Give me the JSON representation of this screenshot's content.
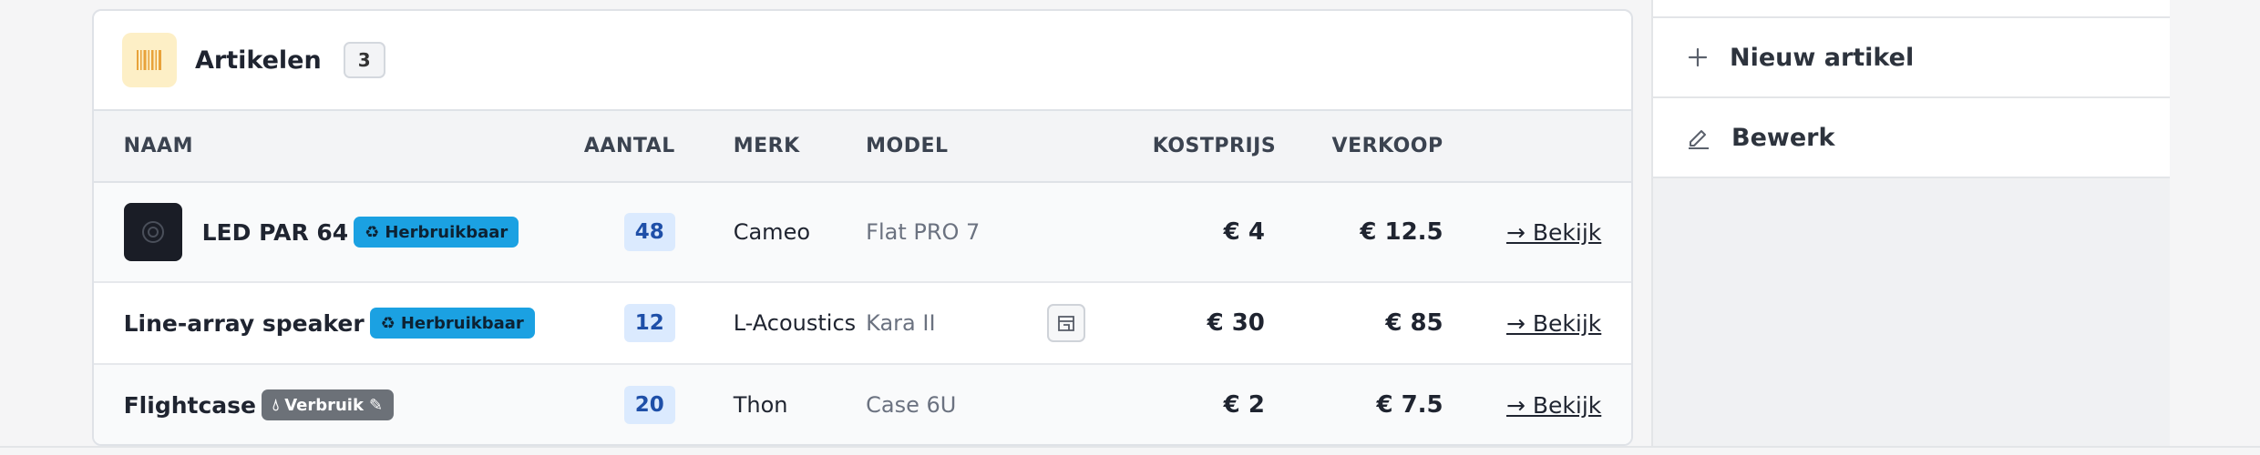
{
  "card": {
    "title": "Artikelen",
    "count": "3",
    "icon": "barcode-icon",
    "columns": {
      "naam": "NAAM",
      "aantal": "AANTAL",
      "merk": "MERK",
      "model": "MODEL",
      "kostprijs": "KOSTPRIJS",
      "verkoop": "VERKOOP"
    },
    "rows": [
      {
        "name": "LED PAR 64",
        "badge": "Herbruikbaar",
        "badge_icon": "recycle-icon",
        "qty": "48",
        "brand": "Cameo",
        "model": "Flat PRO 7",
        "cost": "€ 4",
        "sale": "€ 12.5",
        "link": "→ Bekijk"
      },
      {
        "name": "Line-array speaker",
        "badge": "Herbruikbaar",
        "badge_icon": "recycle-icon",
        "qty": "12",
        "brand": "L-Acoustics",
        "model": "Kara II",
        "cost": "€ 30",
        "sale": "€ 85",
        "link": "→ Bekijk"
      },
      {
        "name": "Flightcase",
        "badge": "Verbruik",
        "badge_icon": "drop-icon",
        "qty": "20",
        "brand": "Thon",
        "model": "Case 6U",
        "cost": "€ 2",
        "sale": "€ 7.5",
        "link": "→ Bekijk"
      }
    ]
  },
  "sidebar": {
    "new_label": "Nieuw artikel",
    "edit_label": "Bewerk"
  },
  "colors": {
    "reuse_badge": "#1ba1e2",
    "consume_badge": "#6c7178",
    "qty_bg": "#dbeafe",
    "icon_bg": "#fdefc6"
  }
}
